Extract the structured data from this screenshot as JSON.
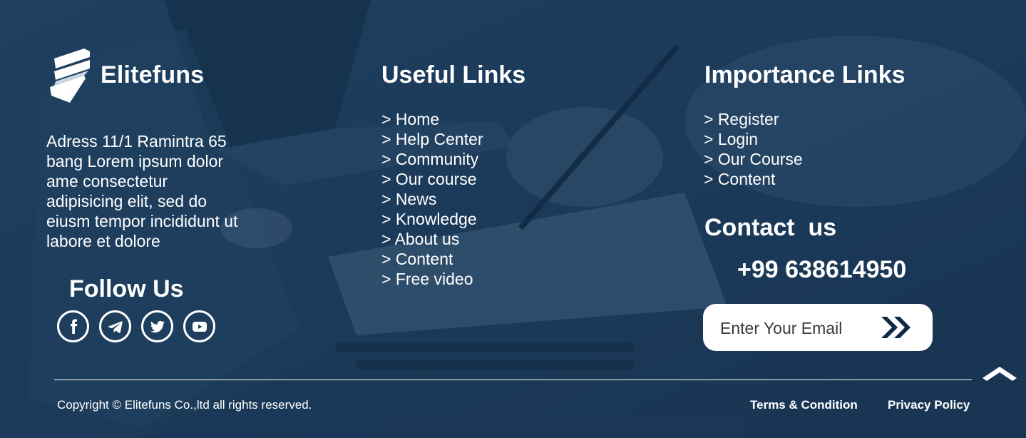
{
  "brand": {
    "name": "Elitefuns",
    "logo_icon": "shield-stripes-icon",
    "address": "Adress 11/1  Ramintra 65 bang Lorem ipsum dolor ame consectetur adipisicing elit, sed do eiusm tempor incididunt ut labore et dolore"
  },
  "follow": {
    "title": "Follow Us",
    "icons": [
      "facebook-icon",
      "telegram-icon",
      "twitter-icon",
      "youtube-icon"
    ]
  },
  "useful_links": {
    "title": "Useful Links",
    "items": [
      "> Home",
      "> Help Center",
      "> Community",
      "> Our course",
      "> News",
      "> Knowledge",
      "> About us",
      "> Content",
      "> Free video"
    ]
  },
  "importance_links": {
    "title": "Importance Links",
    "items": [
      "> Register",
      "> Login",
      "> Our Course",
      "> Content"
    ]
  },
  "contact": {
    "title": "Contact  us",
    "phone": "+99 638614950",
    "email_placeholder": "Enter Your Email",
    "send_icon": "double-chevron-right-icon"
  },
  "bottom": {
    "copyright": "Copyright © Elitefuns Co.,ltd all rights reserved.",
    "terms": "Terms & Condition",
    "privacy": "Privacy Policy",
    "scroll_icon": "chevron-up-icon"
  },
  "colors": {
    "tint": "#1e3d5c",
    "accent": "#0e2a47",
    "text": "#ffffff"
  }
}
